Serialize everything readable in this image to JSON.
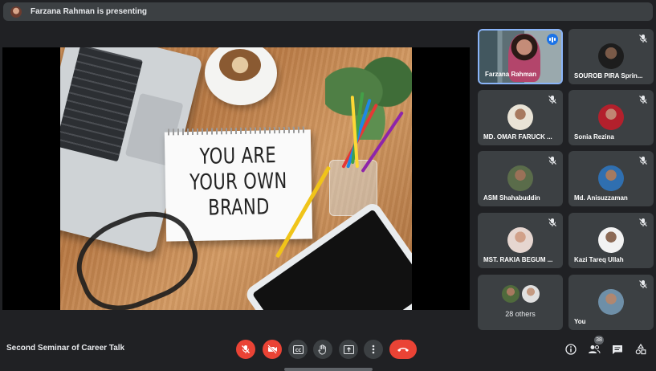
{
  "banner": {
    "text": "Farzana Rahman is presenting"
  },
  "slide": {
    "line1": "YOU ARE",
    "line2": "YOUR OWN",
    "line3": "BRAND"
  },
  "participants": [
    {
      "name": "Farzana Rahman",
      "speaking": true
    },
    {
      "name": "SOUROB PIRA Sprin...",
      "muted": true
    },
    {
      "name": "MD. OMAR FARUCK ...",
      "muted": true
    },
    {
      "name": "Sonia Rezina",
      "muted": true
    },
    {
      "name": "ASM Shahabuddin",
      "muted": true
    },
    {
      "name": "Md. Anisuzzaman",
      "muted": true
    },
    {
      "name": "MST. RAKIA BEGUM ...",
      "muted": true
    },
    {
      "name": "Kazi Tareq Ullah",
      "muted": true
    },
    {
      "name": "28 others"
    },
    {
      "name": "You",
      "muted": true
    }
  ],
  "meeting": {
    "title": "Second Seminar of Career Talk"
  },
  "people_count": "38",
  "icons": {
    "mic": "mic-off-icon",
    "camera": "camera-off-icon",
    "captions": "captions-icon",
    "raise_hand": "raise-hand-icon",
    "present": "present-screen-icon",
    "more": "more-options-icon",
    "end_call": "end-call-icon",
    "info": "info-icon",
    "people": "people-icon",
    "chat": "chat-icon",
    "activities": "activities-icon"
  },
  "colors": {
    "accent": "#8ab4f8",
    "danger": "#ea4335",
    "surface": "#3c4043",
    "background": "#202124"
  }
}
